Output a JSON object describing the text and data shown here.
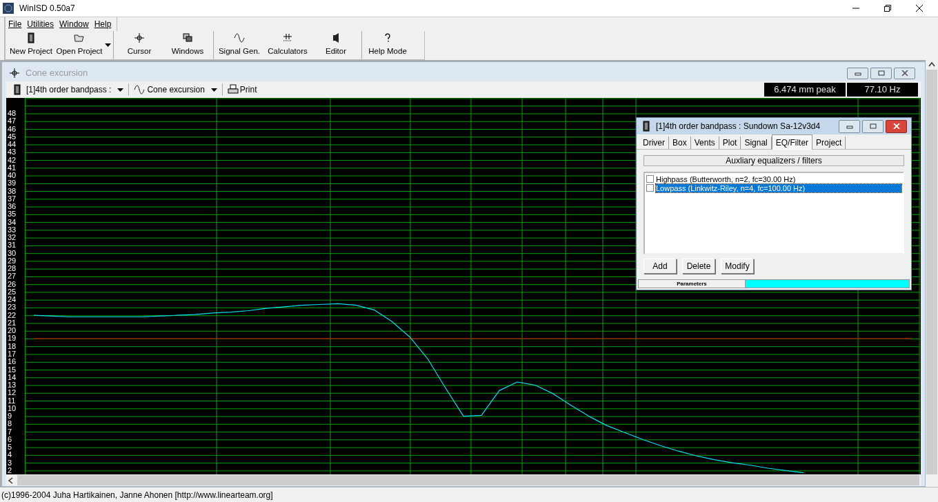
{
  "window": {
    "title": "WinISD 0.50a7"
  },
  "menu": [
    "File",
    "Utilities",
    "Window",
    "Help"
  ],
  "toolbar": [
    {
      "label": "New Project",
      "dropdown": false
    },
    {
      "label": "Open Project",
      "dropdown": true
    },
    {
      "label": "Cursor",
      "dropdown": false
    },
    {
      "label": "Windows",
      "dropdown": false
    },
    {
      "label": "Signal Gen.",
      "dropdown": false
    },
    {
      "label": "Calculators",
      "dropdown": false
    },
    {
      "label": "Editor",
      "dropdown": false
    },
    {
      "label": "Help Mode",
      "dropdown": false
    }
  ],
  "plot_window": {
    "title": "Cone excursion",
    "active": false,
    "project_select": "[1]4th order bandpass :",
    "plot_select": "Cone excursion",
    "print": "Print",
    "readouts": [
      "6.474 mm peak",
      "77.10 Hz"
    ],
    "chart_data": {
      "type": "line",
      "ylim": [
        1.5,
        50
      ],
      "grid": true,
      "yticks": [
        48,
        47,
        46,
        45,
        44,
        43,
        42,
        41,
        40,
        39,
        38,
        37,
        36,
        35,
        34,
        33,
        32,
        31,
        30,
        29,
        28,
        27,
        26,
        25,
        24,
        23,
        22,
        21,
        20,
        19,
        18,
        17,
        16,
        15,
        14,
        13,
        12,
        11,
        10,
        9,
        8,
        7,
        6,
        5,
        4,
        3,
        2
      ],
      "categories": [
        null,
        null,
        null,
        null,
        null,
        null,
        null,
        null,
        null,
        null,
        null,
        null,
        null,
        null,
        null,
        null,
        null,
        null,
        null,
        null,
        null,
        null,
        null,
        null,
        null,
        null,
        null,
        null,
        null,
        null,
        null,
        null,
        null,
        null,
        null,
        null,
        null,
        null,
        null,
        null,
        null,
        null,
        null,
        null,
        null,
        null,
        null,
        null,
        null,
        null
      ],
      "series": [
        {
          "color": "#00e0f0",
          "values": [
            22.0,
            21.9,
            21.8,
            21.8,
            21.8,
            21.8,
            21.8,
            21.9,
            22.0,
            22.1,
            22.3,
            22.4,
            22.6,
            22.9,
            23.1,
            23.3,
            23.4,
            23.5,
            23.3,
            22.7,
            21.2,
            19.2,
            16.4,
            12.6,
            9.0,
            9.1,
            12.3,
            13.4,
            13.0,
            11.9,
            10.4,
            9.0,
            7.8,
            6.9,
            6.0,
            5.2,
            4.5,
            3.9,
            3.4,
            3.0,
            2.7,
            2.3,
            2.0,
            1.7,
            null,
            null,
            null,
            null,
            null,
            null
          ]
        },
        {
          "color": "#e00000",
          "values": [
            19,
            19,
            19,
            19,
            19,
            19,
            19,
            19,
            19,
            19,
            19,
            19,
            19,
            19,
            19,
            19,
            19,
            19,
            19,
            19,
            19,
            19,
            19,
            19,
            19,
            19,
            19,
            19,
            19,
            19,
            19,
            19,
            19,
            19,
            19,
            19,
            19,
            19,
            19,
            19,
            19,
            19,
            19,
            19,
            19,
            19,
            19,
            19,
            19,
            19
          ]
        }
      ]
    }
  },
  "dialog": {
    "title": "[1]4th order bandpass : Sundown Sa-12v3d4",
    "tabs": [
      {
        "label": "Driver",
        "selected": false
      },
      {
        "label": "Box",
        "selected": false
      },
      {
        "label": "Vents",
        "selected": false
      },
      {
        "label": "Plot",
        "selected": false
      },
      {
        "label": "Signal",
        "selected": false
      },
      {
        "label": "EQ/Filter",
        "selected": true
      },
      {
        "label": "Project",
        "selected": false
      }
    ],
    "section_header": "Auxliary equalizers / filters",
    "filters": [
      {
        "label": "Highpass (Butterworth, n=2, fc=30.00 Hz)",
        "checked": false,
        "selected": false
      },
      {
        "label": "Lowpass (Linkwitz-Riley, n=4, fc=100.00 Hz)",
        "checked": false,
        "selected": true
      }
    ],
    "buttons": [
      "Add",
      "Delete",
      "Modify"
    ],
    "footer": "Parameters"
  },
  "status_bar": "(c)1996-2004 Juha Hartikainen, Janne Ahonen [http://www.linearteam.org]"
}
